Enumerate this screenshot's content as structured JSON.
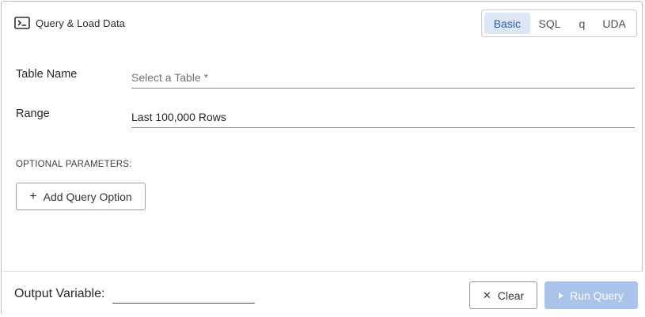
{
  "header": {
    "title": "Query & Load Data",
    "icon": "terminal-icon"
  },
  "mode_tabs": [
    {
      "label": "Basic",
      "active": true
    },
    {
      "label": "SQL",
      "active": false
    },
    {
      "label": "q",
      "active": false
    },
    {
      "label": "UDA",
      "active": false
    }
  ],
  "form": {
    "table_name_label": "Table Name",
    "table_name_placeholder": "Select a Table *",
    "range_label": "Range",
    "range_value": "Last 100,000 Rows",
    "optional_header": "OPTIONAL PARAMETERS:",
    "add_option_label": "Add Query Option"
  },
  "footer": {
    "output_label": "Output Variable:",
    "output_value": "",
    "clear_label": "Clear",
    "run_label": "Run Query",
    "run_enabled": false
  },
  "colors": {
    "accent": "#2c5ea8",
    "active_tab_bg": "#dce6f5",
    "run_disabled_bg": "#a9c3ea"
  }
}
